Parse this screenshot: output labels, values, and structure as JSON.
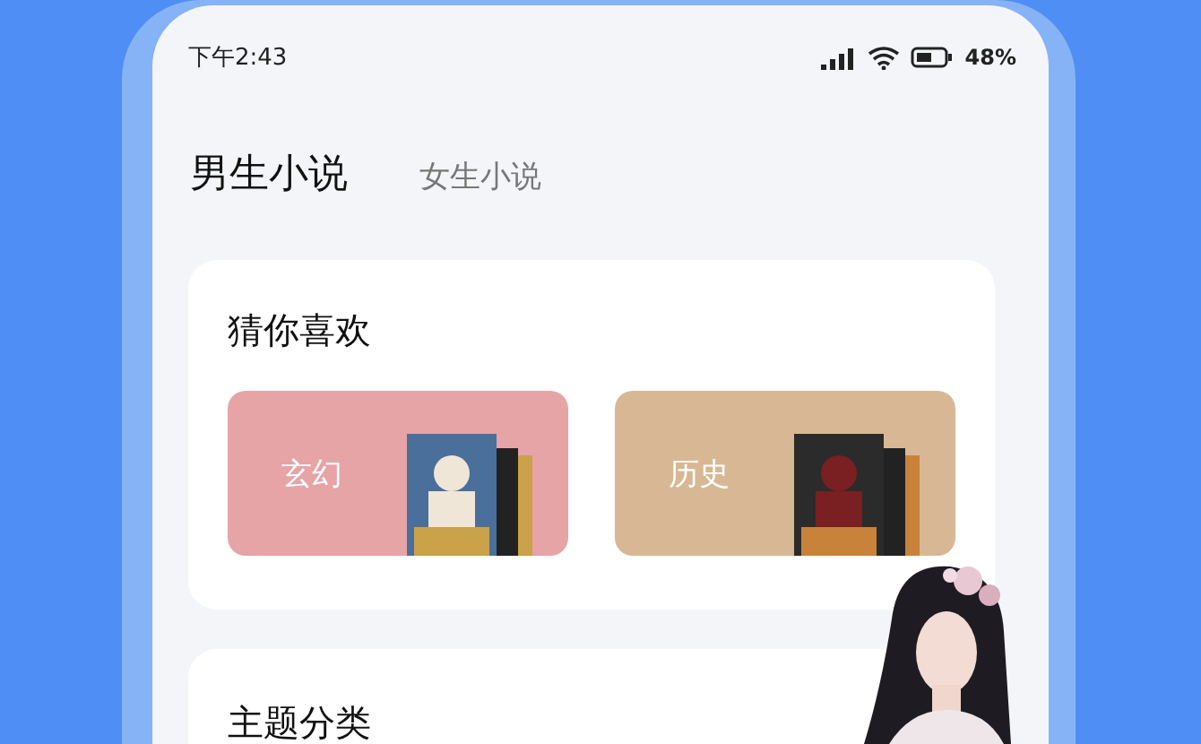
{
  "status_bar": {
    "time": "下午2:43",
    "battery": "48%"
  },
  "tabs": [
    {
      "label": "男生小说",
      "selected": true
    },
    {
      "label": "女生小说",
      "selected": false
    }
  ],
  "sections": [
    {
      "title": "猜你喜欢",
      "genres": [
        {
          "label": "玄幻",
          "color": "#e6a4a7"
        },
        {
          "label": "历史",
          "color": "#d8b894"
        }
      ]
    },
    {
      "title": "主题分类"
    }
  ]
}
